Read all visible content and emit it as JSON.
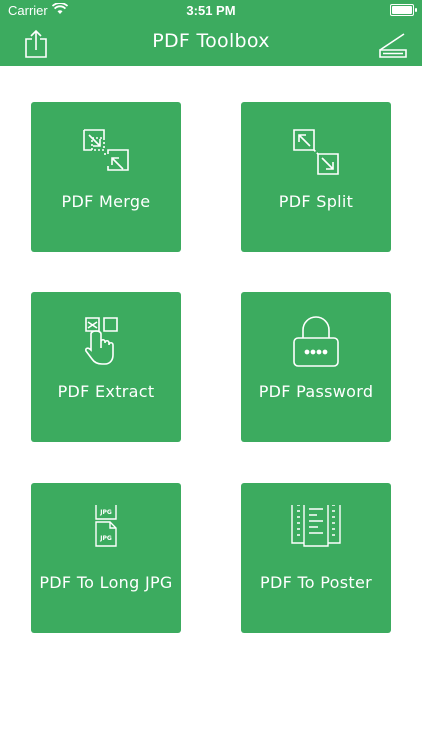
{
  "status": {
    "carrier": "Carrier",
    "time": "3:51 PM"
  },
  "header": {
    "title": "PDF Toolbox"
  },
  "colors": {
    "accent": "#3cab5f",
    "background": "#ffffff",
    "text": "#ffffff"
  },
  "tools": [
    {
      "label": "PDF Merge",
      "icon": "merge-icon"
    },
    {
      "label": "PDF Split",
      "icon": "split-icon"
    },
    {
      "label": "PDF Extract",
      "icon": "extract-icon"
    },
    {
      "label": "PDF Password",
      "icon": "lock-icon"
    },
    {
      "label": "PDF To Long JPG",
      "icon": "jpg-files-icon",
      "icon_text": "JPG"
    },
    {
      "label": "PDF To Poster",
      "icon": "poster-icon"
    }
  ]
}
